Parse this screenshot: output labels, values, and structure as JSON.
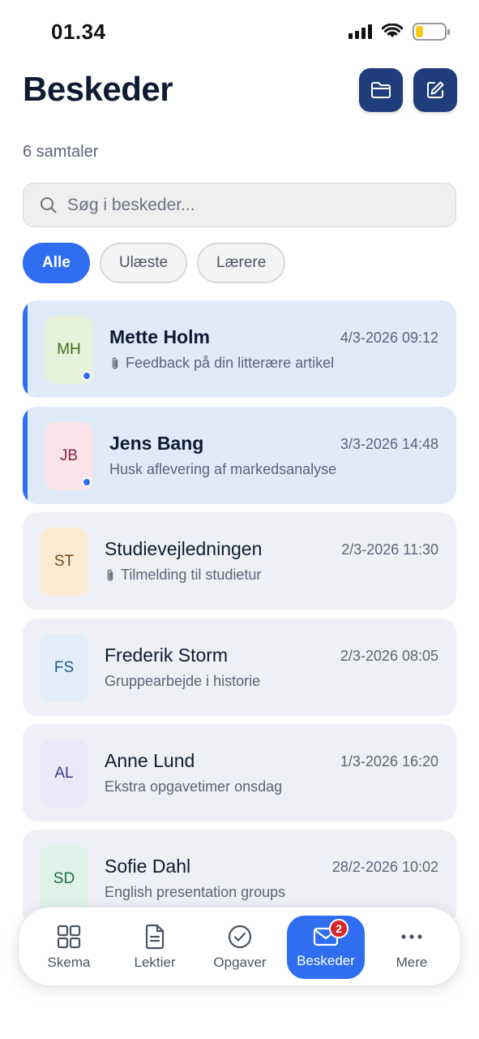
{
  "status_bar": {
    "time": "01.34"
  },
  "header": {
    "title": "Beskeder",
    "conversation_count": "6 samtaler"
  },
  "search": {
    "placeholder": "Søg i beskeder..."
  },
  "filters": [
    {
      "label": "Alle",
      "active": true
    },
    {
      "label": "Ulæste",
      "active": false
    },
    {
      "label": "Lærere",
      "active": false
    }
  ],
  "messages": [
    {
      "initials": "MH",
      "sender": "Mette Holm",
      "date": "4/3-2026 09:12",
      "subject": "Feedback på din litterære artikel",
      "attachment": true,
      "unread": true,
      "avatar_bg": "#e6f2d9",
      "avatar_fg": "#3f6b1c"
    },
    {
      "initials": "JB",
      "sender": "Jens Bang",
      "date": "3/3-2026 14:48",
      "subject": "Husk aflevering af markedsanalyse",
      "attachment": false,
      "unread": true,
      "avatar_bg": "#fbe4ea",
      "avatar_fg": "#8a2343"
    },
    {
      "initials": "ST",
      "sender": "Studievejledningen",
      "date": "2/3-2026 11:30",
      "subject": "Tilmelding til studietur",
      "attachment": true,
      "unread": false,
      "avatar_bg": "#fbebd3",
      "avatar_fg": "#7a4a12"
    },
    {
      "initials": "FS",
      "sender": "Frederik Storm",
      "date": "2/3-2026 08:05",
      "subject": "Gruppearbejde i historie",
      "attachment": false,
      "unread": false,
      "avatar_bg": "#e3eefb",
      "avatar_fg": "#1e5a8a"
    },
    {
      "initials": "AL",
      "sender": "Anne Lund",
      "date": "1/3-2026 16:20",
      "subject": "Ekstra opgavetimer onsdag",
      "attachment": false,
      "unread": false,
      "avatar_bg": "#ebe8fa",
      "avatar_fg": "#3b3a8a"
    },
    {
      "initials": "SD",
      "sender": "Sofie Dahl",
      "date": "28/2-2026 10:02",
      "subject": "English presentation groups",
      "attachment": false,
      "unread": false,
      "avatar_bg": "#dff3ea",
      "avatar_fg": "#1d6b4c"
    }
  ],
  "tabbar": [
    {
      "label": "Skema",
      "icon": "grid-icon"
    },
    {
      "label": "Lektier",
      "icon": "document-icon"
    },
    {
      "label": "Opgaver",
      "icon": "check-circle-icon"
    },
    {
      "label": "Beskeder",
      "icon": "mail-icon",
      "active": true,
      "badge": "2"
    },
    {
      "label": "Mere",
      "icon": "more-dots-icon"
    }
  ],
  "colors": {
    "accent": "#2f6ef0",
    "header_button": "#1f3d7a",
    "badge": "#d62828"
  }
}
